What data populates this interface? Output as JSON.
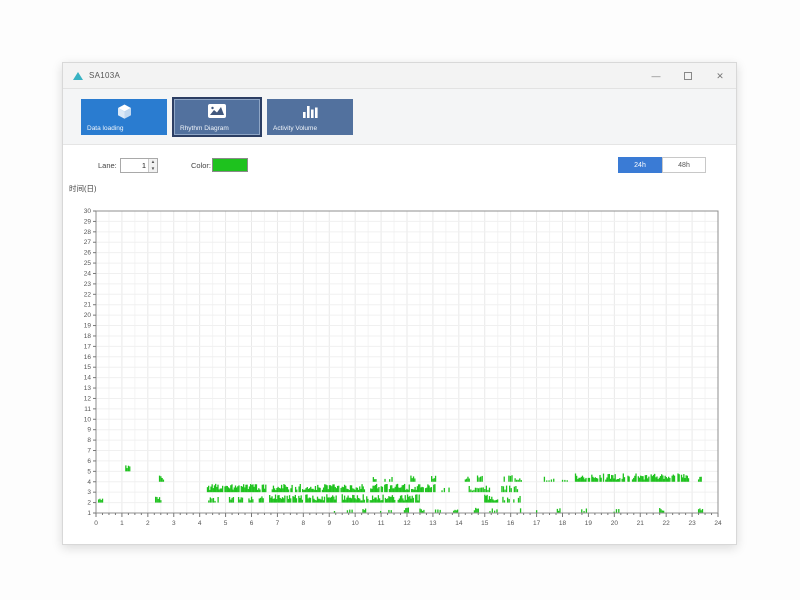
{
  "window": {
    "title": "SA103A",
    "controls": {
      "minimize": "—",
      "close": "✕"
    }
  },
  "toolbar": {
    "buttons": [
      {
        "label": "Data loading",
        "icon": "cube-icon",
        "selected": false
      },
      {
        "label": "Rhythm Diagram",
        "icon": "area-chart-icon",
        "selected": true
      },
      {
        "label": "Activity Volume",
        "icon": "bar-chart-icon",
        "selected": false
      }
    ]
  },
  "controls": {
    "lane_label": "Lane:",
    "lane_value": "1",
    "color_label": "Color:",
    "color_value": "#1ec21e",
    "range_toggle": [
      {
        "label": "24h",
        "active": true
      },
      {
        "label": "48h",
        "active": false
      }
    ]
  },
  "chart_data": {
    "type": "scatter",
    "subtype": "actogram-rhythm-ticks",
    "y_axis_title": "时间(日)",
    "xlim": [
      0,
      24
    ],
    "ylim": [
      1,
      30
    ],
    "x_tick_step": 1,
    "y_tick_step": 1,
    "grid": true,
    "mark_color": "#1ec21e",
    "axis_color": "#8f8f8f",
    "rows": [
      {
        "day": 1,
        "segments": [
          [
            9.2,
            9.4,
            "sparse"
          ],
          [
            9.7,
            10.0,
            "sparse"
          ],
          [
            10.3,
            10.45,
            "isolated"
          ],
          [
            10.8,
            11.0,
            "sparse"
          ],
          [
            11.3,
            11.5,
            "sparse"
          ],
          [
            11.9,
            12.1,
            "isolated"
          ],
          [
            12.5,
            12.7,
            "isolated"
          ],
          [
            13.1,
            13.5,
            "sparse"
          ],
          [
            13.8,
            14.0,
            "isolated"
          ],
          [
            14.6,
            14.8,
            "isolated"
          ],
          [
            15.2,
            15.6,
            "sparse"
          ],
          [
            16.2,
            16.5,
            "sparse"
          ],
          [
            17.0,
            17.4,
            "sparse"
          ],
          [
            17.8,
            17.95,
            "isolated"
          ],
          [
            18.65,
            18.95,
            "sparse"
          ],
          [
            19.9,
            20.25,
            "sparse"
          ],
          [
            21.75,
            21.95,
            "isolated"
          ],
          [
            23.25,
            23.45,
            "isolated"
          ]
        ]
      },
      {
        "day": 2,
        "segments": [
          [
            0.1,
            0.28,
            "isolated"
          ],
          [
            2.3,
            2.5,
            "isolated"
          ],
          [
            4.35,
            4.75,
            "medium"
          ],
          [
            5.15,
            5.3,
            "isolated"
          ],
          [
            5.5,
            5.65,
            "isolated"
          ],
          [
            5.9,
            6.05,
            "isolated"
          ],
          [
            6.3,
            6.45,
            "isolated"
          ],
          [
            6.7,
            9.3,
            "dense"
          ],
          [
            9.5,
            12.5,
            "dense"
          ],
          [
            15.0,
            15.5,
            "dense"
          ],
          [
            15.7,
            16.4,
            "medium"
          ]
        ]
      },
      {
        "day": 3,
        "segments": [
          [
            4.3,
            6.6,
            "dense"
          ],
          [
            6.8,
            10.4,
            "dense"
          ],
          [
            10.6,
            13.1,
            "dense"
          ],
          [
            13.35,
            13.8,
            "sparse"
          ],
          [
            14.4,
            15.2,
            "medium"
          ],
          [
            15.6,
            16.35,
            "medium"
          ]
        ]
      },
      {
        "day": 4,
        "segments": [
          [
            2.45,
            2.6,
            "isolated"
          ],
          [
            10.7,
            10.85,
            "isolated"
          ],
          [
            11.15,
            11.45,
            "sparse"
          ],
          [
            12.15,
            12.35,
            "isolated"
          ],
          [
            12.95,
            13.15,
            "isolated"
          ],
          [
            14.25,
            14.45,
            "isolated"
          ],
          [
            14.6,
            15.0,
            "medium"
          ],
          [
            15.75,
            16.45,
            "medium"
          ],
          [
            16.8,
            17.05,
            "sparse"
          ],
          [
            17.3,
            17.85,
            "sparse"
          ],
          [
            18.0,
            18.25,
            "sparse"
          ],
          [
            18.5,
            20.6,
            "dense"
          ],
          [
            20.7,
            22.9,
            "dense"
          ],
          [
            23.25,
            23.4,
            "isolated"
          ]
        ]
      },
      {
        "day": 5,
        "segments": [
          [
            1.15,
            1.3,
            "isolated"
          ]
        ]
      }
    ]
  }
}
